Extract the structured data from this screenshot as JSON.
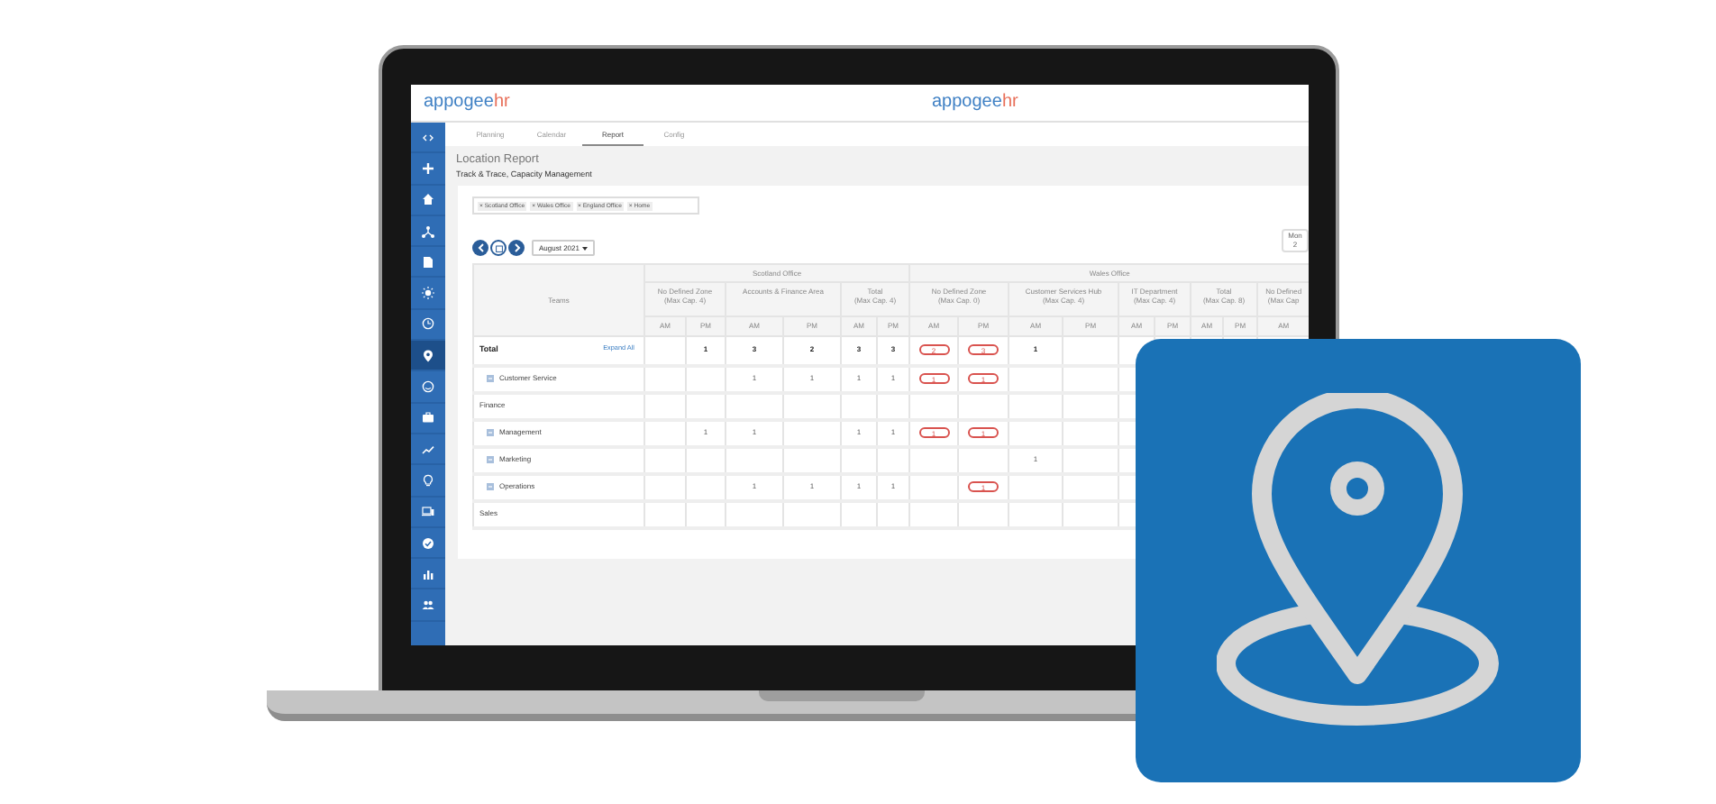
{
  "header": {
    "logo_left": {
      "main": "appogee",
      "accent": "hr"
    },
    "logo_center": {
      "main": "appogee",
      "accent": "hr"
    }
  },
  "sidebar": {
    "items": [
      {
        "selected": false
      },
      {
        "selected": false
      },
      {
        "selected": false
      },
      {
        "selected": false
      },
      {
        "selected": false
      },
      {
        "selected": false
      },
      {
        "selected": false
      },
      {
        "selected": true
      },
      {
        "selected": false
      },
      {
        "selected": false
      },
      {
        "selected": false
      },
      {
        "selected": false
      },
      {
        "selected": false
      },
      {
        "selected": false
      },
      {
        "selected": false
      },
      {
        "selected": false
      }
    ]
  },
  "tabs": [
    {
      "label": "Planning",
      "selected": false
    },
    {
      "label": "Calendar",
      "selected": false
    },
    {
      "label": "Report",
      "selected": true
    },
    {
      "label": "Config",
      "selected": false
    }
  ],
  "page": {
    "title": "Location Report",
    "subtitle": "Track & Trace, Capacity Management"
  },
  "filters": [
    {
      "label": "× Scotland Office"
    },
    {
      "label": "× Wales Office"
    },
    {
      "label": "× England Office"
    },
    {
      "label": "× Home"
    }
  ],
  "date_nav": {
    "month": "August 2021"
  },
  "day_badge": {
    "weekday": "Mon",
    "day": "2"
  },
  "table": {
    "teams_header": "Teams",
    "offices": [
      {
        "name": "Scotland Office",
        "zones": [
          {
            "name": "No Defined Zone",
            "cap": "(Max Cap. 4)",
            "columns": [
              "AM",
              "PM"
            ]
          },
          {
            "name": "Accounts & Finance Area",
            "columns": [
              "AM",
              "PM"
            ]
          },
          {
            "name": "Total",
            "cap": "(Max Cap. 4)",
            "columns": [
              "AM",
              "PM"
            ]
          }
        ]
      },
      {
        "name": "Wales Office",
        "zones": [
          {
            "name": "No Defined Zone",
            "cap": "(Max Cap. 0)",
            "columns": [
              "AM",
              "PM"
            ]
          },
          {
            "name": "Customer Services Hub",
            "cap": "(Max Cap. 4)",
            "columns": [
              "AM",
              "PM"
            ]
          },
          {
            "name": "IT Department",
            "cap": "(Max Cap. 4)",
            "columns": [
              "AM",
              "PM"
            ]
          },
          {
            "name": "Total",
            "cap": "(Max Cap. 8)",
            "columns": [
              "AM",
              "PM"
            ]
          },
          {
            "name": "No Defined",
            "cap": "(Max Cap",
            "columns": [
              "AM"
            ]
          }
        ]
      }
    ],
    "rows": [
      {
        "kind": "total",
        "label": "Total",
        "action": "Expand All",
        "cells": [
          null,
          {
            "text": "1",
            "over": false
          },
          {
            "text": "3",
            "over": false
          },
          {
            "text": "2",
            "over": false
          },
          {
            "text": "3",
            "over": false
          },
          {
            "text": "3",
            "over": false
          },
          {
            "text": "2",
            "over": true
          },
          {
            "text": "3",
            "over": true
          },
          {
            "text": "1",
            "over": false
          },
          null
        ]
      },
      {
        "kind": "team",
        "label": "Customer Service",
        "cells": [
          null,
          null,
          {
            "text": "1",
            "over": false
          },
          {
            "text": "1",
            "over": false
          },
          {
            "text": "1",
            "over": false
          },
          {
            "text": "1",
            "over": false
          },
          {
            "text": "1",
            "over": true
          },
          {
            "text": "1",
            "over": true
          },
          null,
          null
        ]
      },
      {
        "kind": "group",
        "label": "Finance"
      },
      {
        "kind": "team",
        "label": "Management",
        "cells": [
          null,
          {
            "text": "1",
            "over": false
          },
          {
            "text": "1",
            "over": false
          },
          null,
          {
            "text": "1",
            "over": false
          },
          {
            "text": "1",
            "over": false
          },
          {
            "text": "1",
            "over": true
          },
          {
            "text": "1",
            "over": true
          },
          null,
          null
        ]
      },
      {
        "kind": "team",
        "label": "Marketing",
        "cells": [
          null,
          null,
          null,
          null,
          null,
          null,
          null,
          null,
          {
            "text": "1",
            "over": false
          },
          null
        ]
      },
      {
        "kind": "team",
        "label": "Operations",
        "cells": [
          null,
          null,
          {
            "text": "1",
            "over": false
          },
          {
            "text": "1",
            "over": false
          },
          {
            "text": "1",
            "over": false
          },
          {
            "text": "1",
            "over": false
          },
          null,
          {
            "text": "1",
            "over": true
          },
          null,
          null
        ]
      },
      {
        "kind": "group",
        "label": "Sales"
      }
    ]
  }
}
